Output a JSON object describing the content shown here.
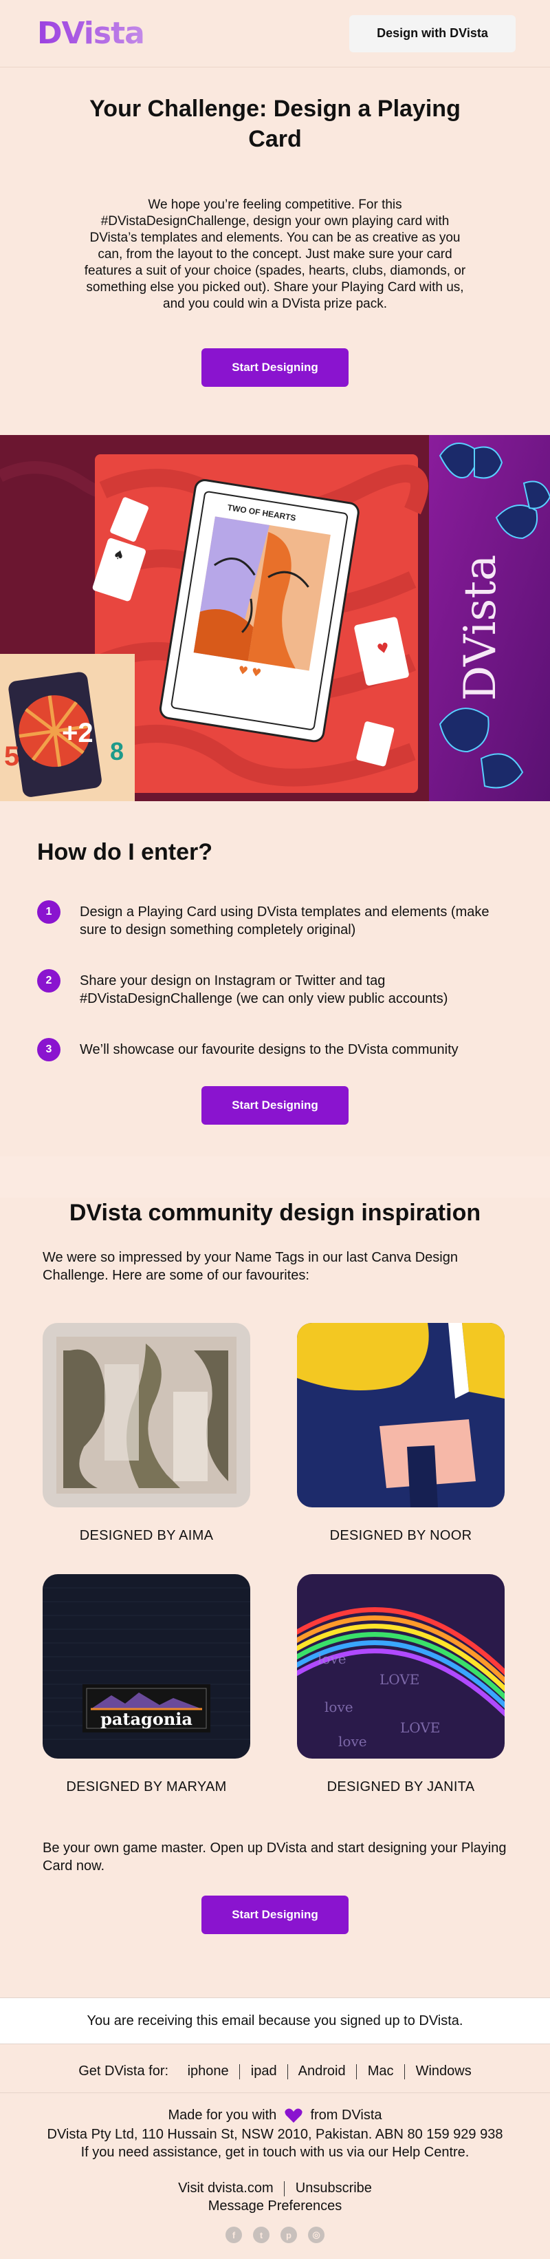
{
  "header": {
    "logo": "DVista",
    "cta_label": "Design with DVista"
  },
  "intro": {
    "title": "Your Challenge: Design a Playing Card",
    "body": "We hope you’re feeling competitive. For this #DVistaDesignChallenge, design your own playing card with DVista’s templates and elements. You can be as creative as you can, from the layout to the concept. Just make sure your card features a suit of your choice (spades, hearts, clubs, diamonds, or something else you picked out). Share your Playing Card with us, and you could win a DVista prize pack.",
    "button_label": "Start Designing"
  },
  "hero": {
    "card_title": "TWO OF HEARTS",
    "side_logo": "DVista",
    "mini_card_text": "+2",
    "mini_numbers": [
      "5",
      "8"
    ]
  },
  "enter": {
    "title": "How do I enter?",
    "steps": [
      {
        "num": "1",
        "text": "Design a Playing Card using DVista templates and elements (make sure to design something completely original)"
      },
      {
        "num": "2",
        "text": "Share your design on Instagram or Twitter and tag #DVistaDesignChallenge (we can only view public accounts)"
      },
      {
        "num": "3",
        "text": "We’ll showcase our favourite designs to the DVista community"
      }
    ],
    "button_label": "Start Designing"
  },
  "community": {
    "title": "DVista community design inspiration",
    "lead": "We were so impressed by your Name Tags in our last Canva Design Challenge. Here are some of our favourites:",
    "designs": [
      {
        "caption": "DESIGNED BY AIMA"
      },
      {
        "caption": "DESIGNED BY NOOR"
      },
      {
        "caption": "DESIGNED BY MARYAM",
        "badge_text": "patagonia"
      },
      {
        "caption": "DESIGNED BY JANITA"
      }
    ],
    "outro": "Be your own game master. Open up DVista and start designing your Playing Card now.",
    "button_label": "Start Designing"
  },
  "footer": {
    "notice": "You are receiving this email because you signed up to DVista.",
    "get_label": "Get DVista for:",
    "platforms": [
      "iphone",
      "ipad",
      "Android",
      "Mac",
      "Windows"
    ],
    "made_prefix": "Made for you with",
    "made_suffix": "from DVista",
    "address": "DVista Pty Ltd, 110 Hussain St, NSW 2010, Pakistan. ABN 80 159 929 938",
    "assistance": "If you need assistance, get in touch with us via our Help Centre.",
    "visit": "Visit dvista.com",
    "unsubscribe": "Unsubscribe",
    "preferences": "Message Preferences",
    "social_icons": [
      "facebook-icon",
      "twitter-icon",
      "pinterest-icon",
      "instagram-icon"
    ]
  },
  "colors": {
    "accent": "#8a14cf",
    "background": "#fae8de",
    "hero_maroon": "#6b1630",
    "hero_purple": "#8a1c9c"
  }
}
